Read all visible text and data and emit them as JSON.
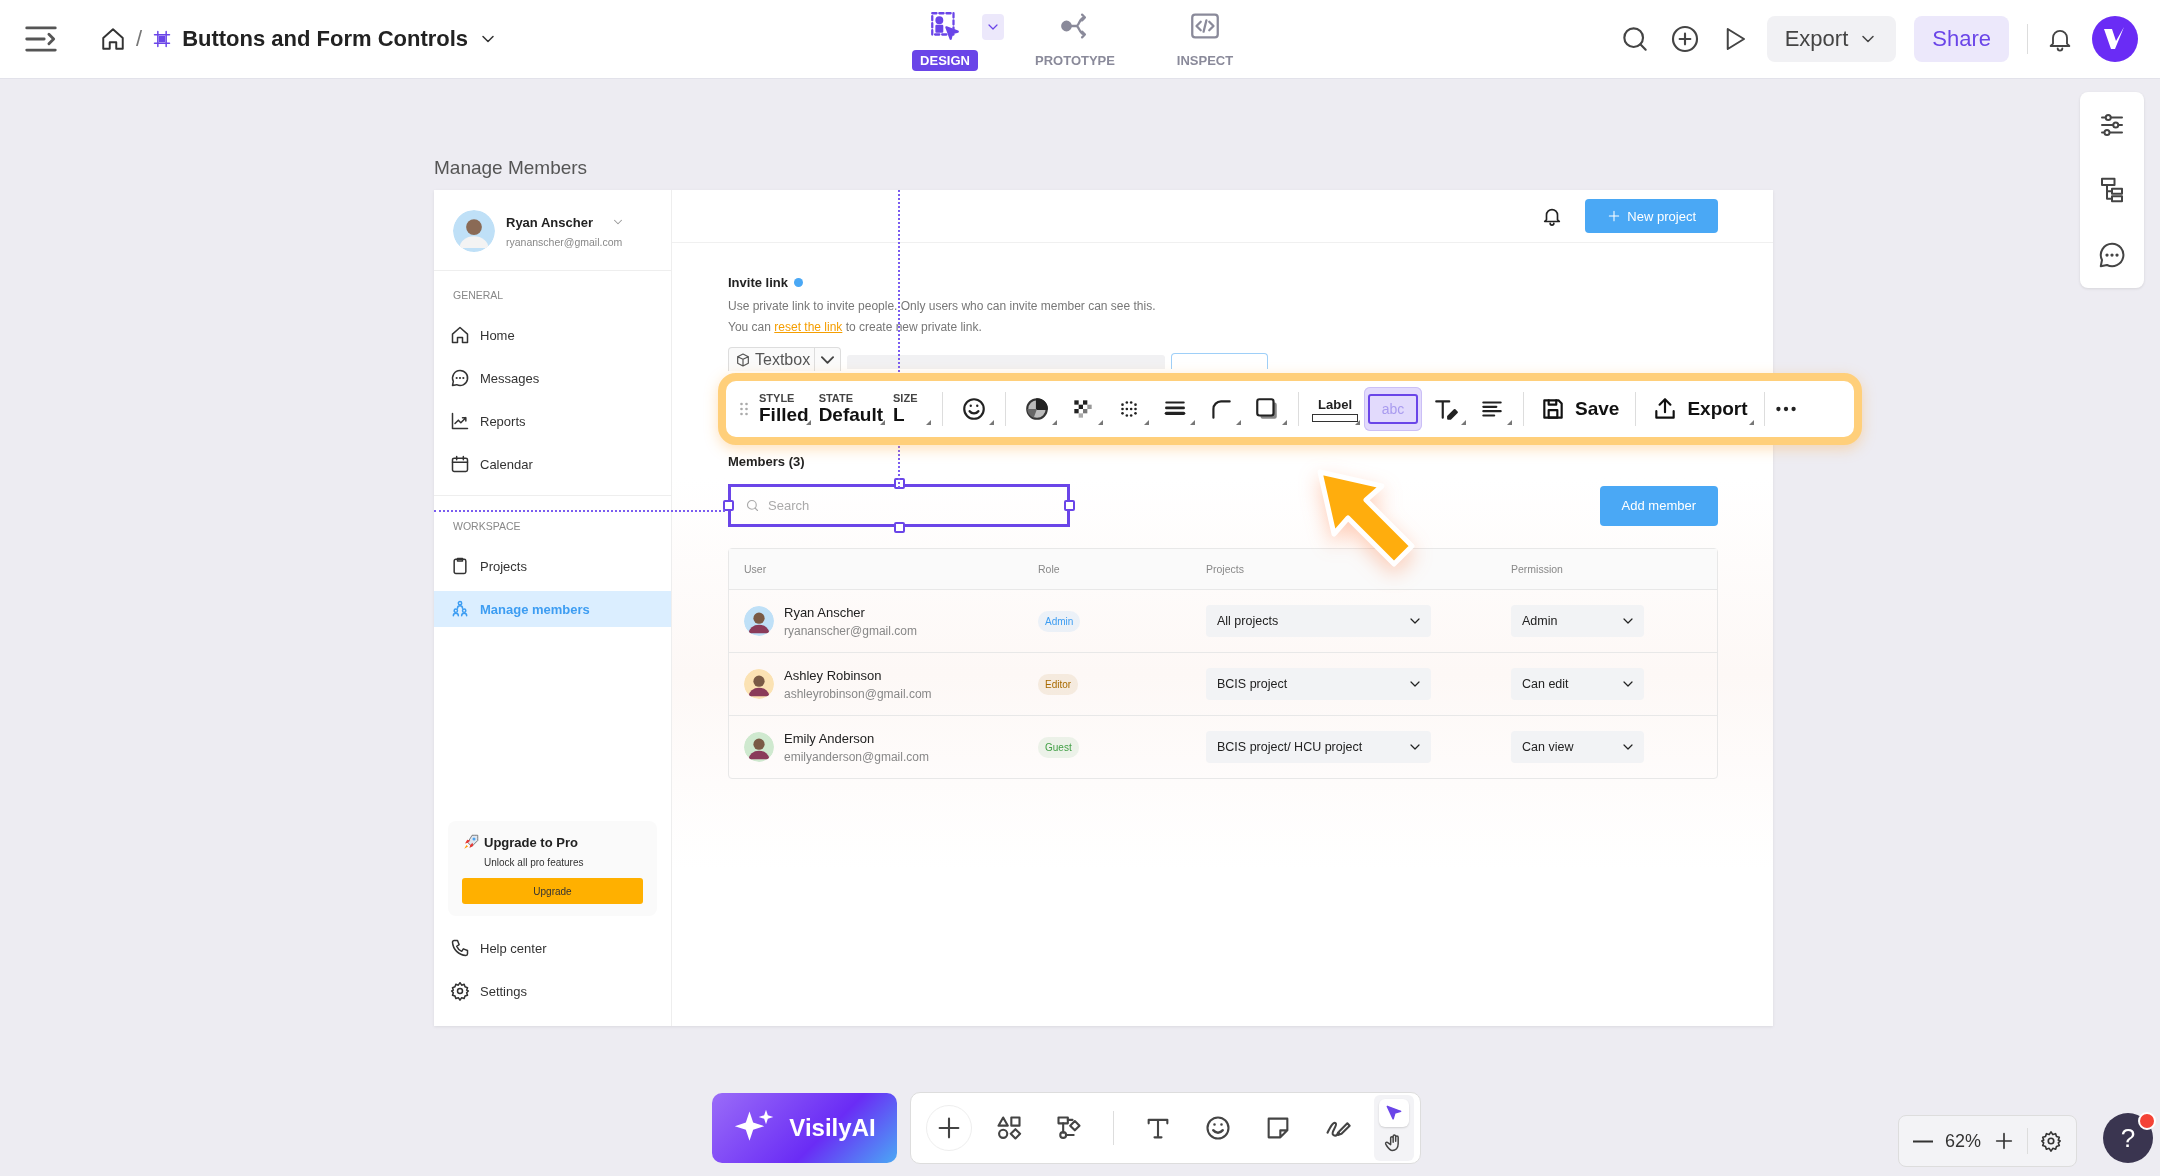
{
  "top_bar": {
    "separator": "/",
    "title": "Buttons and Form Controls",
    "tabs": [
      {
        "label": "DESIGN",
        "selected": true
      },
      {
        "label": "PROTOTYPE",
        "selected": false
      },
      {
        "label": "INSPECT",
        "selected": false
      }
    ],
    "export_button": "Export",
    "share_button": "Share"
  },
  "frame": {
    "title": "Manage Members",
    "sidebar": {
      "profile": {
        "name": "Ryan Anscher",
        "email": "ryananscher@gmail.com"
      },
      "sections": [
        {
          "heading": "GENERAL",
          "items": [
            {
              "label": "Home",
              "selected": false
            },
            {
              "label": "Messages",
              "selected": false
            },
            {
              "label": "Reports",
              "selected": false
            },
            {
              "label": "Calendar",
              "selected": false
            }
          ]
        },
        {
          "heading": "WORKSPACE",
          "items": [
            {
              "label": "Projects",
              "selected": false
            },
            {
              "label": "Manage members",
              "selected": true
            }
          ]
        }
      ],
      "upgrade": {
        "title": "Upgrade to Pro",
        "text": "Unlock all pro features",
        "button": "Upgrade"
      },
      "footer_items": [
        {
          "label": "Help center",
          "selected": false
        },
        {
          "label": "Settings",
          "selected": false
        }
      ]
    },
    "main": {
      "new_project_button": "New project",
      "invite": {
        "title": "Invite link",
        "line_1": "Use private link to invite people. Only users who can invite member can see this.",
        "line_2_before": "You can",
        "link": "reset the link",
        "line_2_after": "to create new private link.",
        "component_chip": "Textbox"
      },
      "members_title": "Members (3)",
      "search": {
        "placeholder": "Search"
      },
      "add_member_button": "Add member",
      "table": {
        "columns": [
          "User",
          "Role",
          "Projects",
          "Permission"
        ],
        "rows": [
          {
            "name": "Ryan Anscher",
            "email": "ryananscher@gmail.com",
            "role": "Admin",
            "color": "#3d9df2",
            "project": "All projects",
            "permission": "Admin"
          },
          {
            "name": "Ashley Robinson",
            "email": "ashleyrobinson@gmail.com",
            "role": "Editor",
            "color": "#a86a00",
            "project": "BCIS project",
            "permission": "Can edit"
          },
          {
            "name": "Emily Anderson",
            "email": "emilyanderson@gmail.com",
            "role": "Guest",
            "color": "#43a047",
            "project": "BCIS project/ HCU project",
            "permission": "Can view"
          }
        ]
      }
    }
  },
  "toolbar": {
    "properties": [
      {
        "label": "STYLE",
        "value": "Filled"
      },
      {
        "label": "STATE",
        "value": "Default"
      },
      {
        "label": "SIZE",
        "value": "L"
      }
    ],
    "tool_groups": [
      [
        {
          "kind": "smiley",
          "selected": false
        }
      ],
      [
        {
          "kind": "fill",
          "selected": false
        },
        {
          "kind": "checker",
          "selected": false
        },
        {
          "kind": "dots",
          "selected": false
        },
        {
          "kind": "lines",
          "selected": false
        },
        {
          "kind": "corner",
          "selected": false
        },
        {
          "kind": "shadow",
          "selected": false
        }
      ],
      [
        {
          "kind": "label",
          "text": "Label",
          "selected": false
        },
        {
          "kind": "input",
          "text": "abc",
          "selected": true
        },
        {
          "kind": "text-style",
          "selected": false
        },
        {
          "kind": "align",
          "selected": false
        }
      ]
    ],
    "save_button": "Save",
    "export_button": "Export"
  },
  "bottom_toolbar": {
    "ai_button": "VisilyAI",
    "tool_groups": [
      [
        {
          "kind": "plus",
          "selected": false
        },
        {
          "kind": "shapes",
          "selected": false
        },
        {
          "kind": "flow",
          "selected": false
        }
      ],
      [
        {
          "kind": "text",
          "selected": false
        },
        {
          "kind": "smiley",
          "selected": false
        },
        {
          "kind": "sticky",
          "selected": false
        },
        {
          "kind": "pen",
          "selected": false
        }
      ]
    ],
    "pointer_tools": [
      {
        "kind": "pointer",
        "selected": true
      },
      {
        "kind": "hand",
        "selected": false
      }
    ]
  },
  "zoom": {
    "value": "62%"
  },
  "help": {
    "label": "?"
  }
}
